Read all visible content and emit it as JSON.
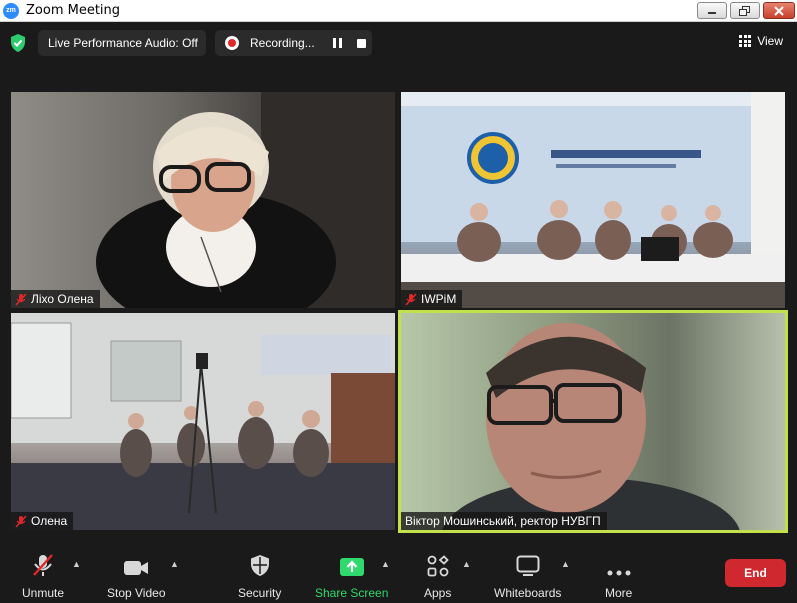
{
  "window": {
    "app_logo": "zm",
    "title": "Zoom Meeting",
    "buttons": [
      "minimize",
      "restore",
      "close"
    ]
  },
  "topbar": {
    "audio_label": "Live Performance Audio: Off",
    "recording_label": "Recording...",
    "view_label": "View",
    "security_status_color": "#2ecc71"
  },
  "participants": [
    {
      "name": "Ліхо Олена",
      "muted": true,
      "active_speaker": false
    },
    {
      "name": "IWPiM",
      "muted": true,
      "active_speaker": false
    },
    {
      "name": "Олена",
      "muted": true,
      "active_speaker": false
    },
    {
      "name": "Віктор Мошинський, ректор НУВГП",
      "muted": false,
      "active_speaker": true
    }
  ],
  "toolbar": {
    "unmute": "Unmute",
    "stop_video": "Stop Video",
    "security": "Security",
    "share_screen": "Share Screen",
    "apps": "Apps",
    "whiteboards": "Whiteboards",
    "more": "More",
    "end": "End"
  },
  "colors": {
    "active_speaker_border": "#c3e14a",
    "share_green": "#2fd96d",
    "end_red": "#d0282f"
  }
}
